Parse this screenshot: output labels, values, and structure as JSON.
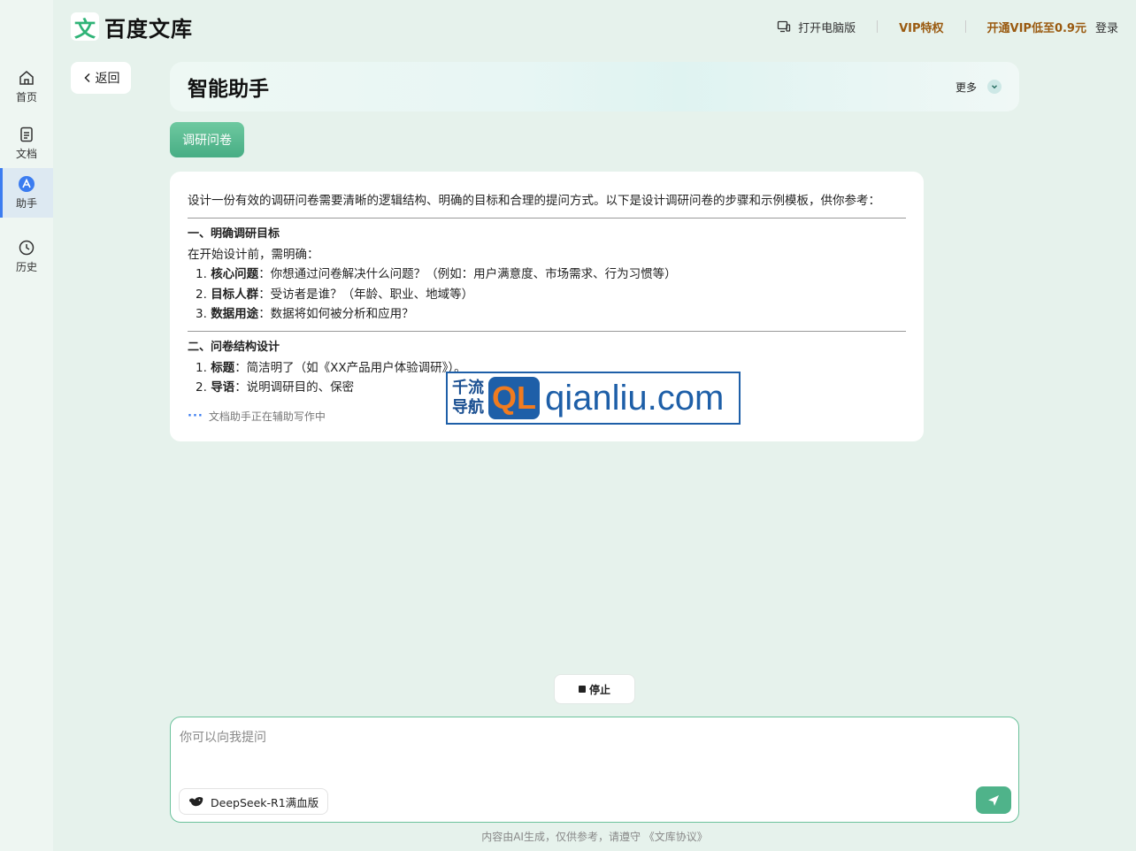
{
  "brand": {
    "logo_char": "文",
    "name": "百度文库"
  },
  "topbar": {
    "desktop": "打开电脑版",
    "vip": "VIP特权",
    "vip_open": "开通VIP低至0.9元",
    "login": "登录"
  },
  "sidebar": {
    "items": [
      {
        "label": "首页",
        "icon": "home-icon"
      },
      {
        "label": "文档",
        "icon": "document-icon"
      },
      {
        "label": "助手",
        "icon": "assistant-icon",
        "active": true
      },
      {
        "label": "历史",
        "icon": "clock-icon"
      }
    ]
  },
  "back_label": "返回",
  "title_card": {
    "title": "智能助手",
    "more": "更多"
  },
  "chip_label": "调研问卷",
  "answer": {
    "intro": "设计一份有效的调研问卷需要清晰的逻辑结构、明确的目标和合理的提问方式。以下是设计调研问卷的步骤和示例模板，供你参考：",
    "section1": {
      "heading": "一、明确调研目标",
      "lead": "在开始设计前，需明确：",
      "items": [
        {
          "num": "1.",
          "key": "核心问题",
          "text": "：你想通过问卷解决什么问题？（例如：用户满意度、市场需求、行为习惯等）"
        },
        {
          "num": "2.",
          "key": "目标人群",
          "text": "：受访者是谁？（年龄、职业、地域等）"
        },
        {
          "num": "3.",
          "key": "数据用途",
          "text": "：数据将如何被分析和应用？"
        }
      ]
    },
    "section2": {
      "heading": "二、问卷结构设计",
      "items": [
        {
          "num": "1.",
          "key": "标题",
          "text": "：简洁明了（如《XX产品用户体验调研》）。"
        },
        {
          "num": "2.",
          "key": "导语",
          "text": "：说明调研目的、保密"
        }
      ]
    },
    "status": "文档助手正在辅助写作中"
  },
  "watermark": {
    "cn_top": "千流",
    "cn_bottom": "导航",
    "badge": "QL",
    "domain": "qianliu.com"
  },
  "stop_label": "停止",
  "input": {
    "placeholder": "你可以向我提问",
    "model": "DeepSeek-R1满血版"
  },
  "footer": "内容由AI生成，仅供参考，请遵守 《文库协议》",
  "colors": {
    "accent": "#4fb38a",
    "vip": "#9a5a10",
    "active_nav": "#3b7cf0"
  }
}
